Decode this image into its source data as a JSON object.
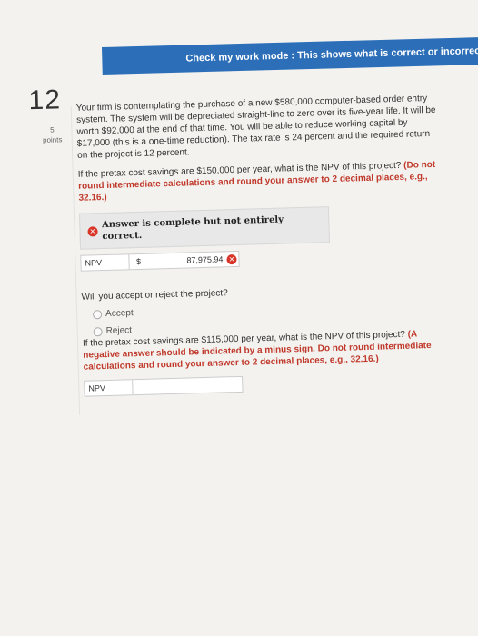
{
  "banner": {
    "text": "Check my work mode : This shows what is correct or incorrect for the work you have"
  },
  "question": {
    "number": "12",
    "points_value": "5",
    "points_label": "points",
    "paragraph1": "Your firm is contemplating the purchase of a new $580,000 computer-based order entry system. The system will be depreciated straight-line to zero over its five-year life. It will be worth $92,000 at the end of that time. You will be able to reduce working capital by $17,000 (this is a one-time reduction). The tax rate is 24 percent and the required return on the project is 12 percent.",
    "part1_prefix": "If the pretax cost savings are $150,000 per year, what is the NPV of this project? ",
    "part1_bold": "(Do not round intermediate calculations and round your answer to 2 decimal places, e.g., 32.16.)",
    "status": "Answer is complete but not entirely correct.",
    "npv_label": "NPV",
    "npv_currency": "$",
    "npv_value": "87,975.94",
    "accept_question": "Will you accept or reject the project?",
    "options": [
      "Accept",
      "Reject"
    ],
    "part2_prefix": "If the pretax cost savings are $115,000 per year, what is the NPV of this project? ",
    "part2_bold": "(A negative answer should be indicated by a minus sign. Do not round intermediate calculations and round your answer to 2 decimal places, e.g., 32.16.)",
    "npv2_label": "NPV"
  },
  "colors": {
    "banner": "#2c6fb8",
    "error": "#d9362b",
    "instruction": "#c0392b"
  }
}
